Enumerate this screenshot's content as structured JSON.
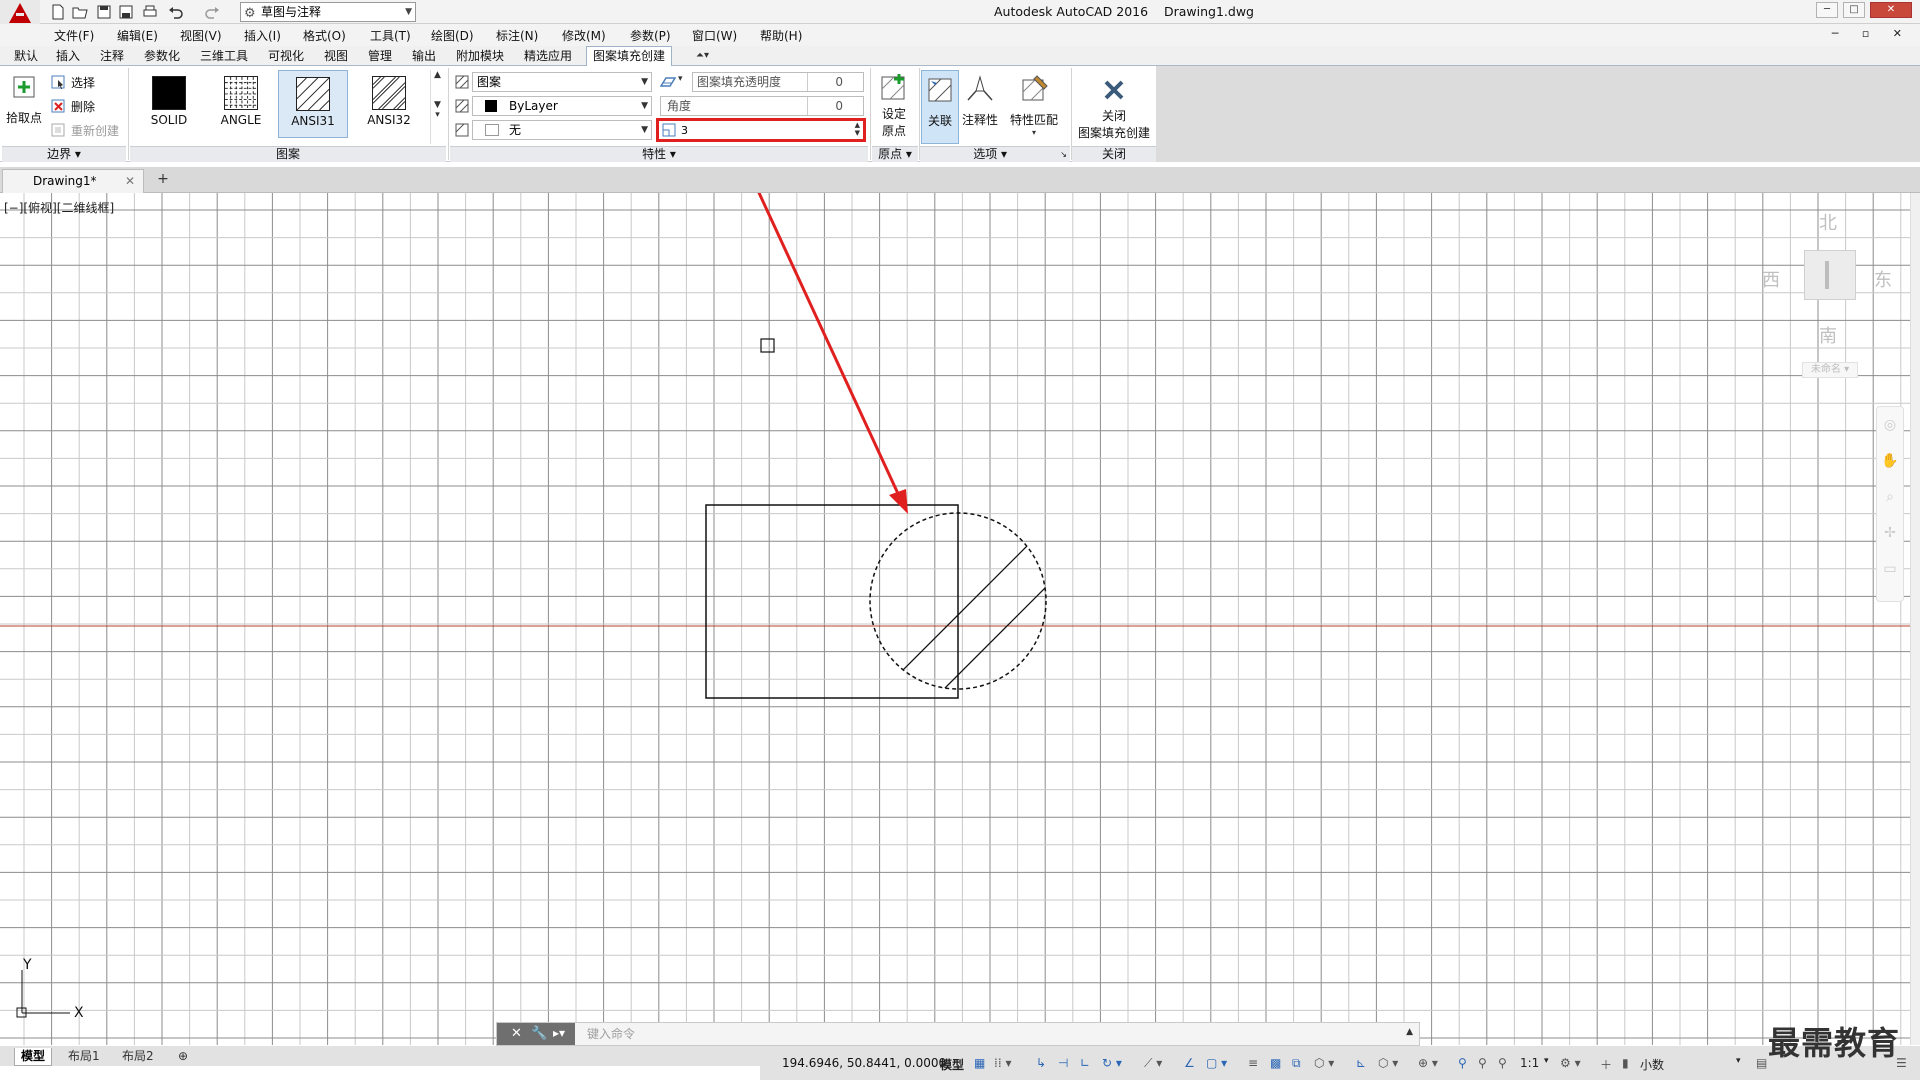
{
  "titlebar": {
    "app_title": "Autodesk AutoCAD 2016",
    "doc_title": "Drawing1.dwg",
    "workspace": "草图与注释",
    "window_buttons": [
      "─",
      "□",
      "✕"
    ]
  },
  "menubar": {
    "items": [
      "文件(F)",
      "编辑(E)",
      "视图(V)",
      "插入(I)",
      "格式(O)",
      "工具(T)",
      "绘图(D)",
      "标注(N)",
      "修改(M)",
      "参数(P)",
      "窗口(W)",
      "帮助(H)"
    ]
  },
  "ribbon_tabs": {
    "items": [
      "默认",
      "插入",
      "注释",
      "参数化",
      "三维工具",
      "可视化",
      "视图",
      "管理",
      "输出",
      "附加模块",
      "精选应用",
      "图案填充创建"
    ],
    "active_index": 11
  },
  "ribbon": {
    "boundary": {
      "pick_points": "拾取点",
      "select": "选择",
      "remove": "删除",
      "recreate": "重新创建",
      "panel_title": "边界"
    },
    "pattern": {
      "tiles": [
        "SOLID",
        "ANGLE",
        "ANSI31",
        "ANSI32"
      ],
      "selected": "ANSI31",
      "panel_title": "图案"
    },
    "properties": {
      "type_value": "图案",
      "color_value": "ByLayer",
      "bg_value": "无",
      "transparency_label": "图案填充透明度",
      "transparency_value": "0",
      "angle_label": "角度",
      "angle_value": "0",
      "scale_value": "3",
      "panel_title": "特性"
    },
    "origin": {
      "set_origin_line1": "设定",
      "set_origin_line2": "原点",
      "panel_title": "原点"
    },
    "options": {
      "associative": "关联",
      "annotative": "注释性",
      "match_props": "特性匹配",
      "panel_title": "选项"
    },
    "close": {
      "label_line1": "关闭",
      "label_line2": "图案填充创建",
      "panel_title": "关闭"
    }
  },
  "doc_tab": {
    "name": "Drawing1*"
  },
  "viewport": {
    "label": "[−][俯视][二维线框]"
  },
  "viewcube": {
    "north": "北",
    "south": "南",
    "east": "东",
    "west": "西",
    "ucs_name": "未命名"
  },
  "ucs": {
    "x": "X",
    "y": "Y"
  },
  "cmdline": {
    "placeholder": "键入命令"
  },
  "layout_tabs": [
    "模型",
    "布局1",
    "布局2"
  ],
  "statusbar": {
    "coords": "194.6946, 50.8441, 0.0000",
    "model": "模型",
    "scale": "1:1",
    "units": "小数"
  },
  "watermark": "最需教育",
  "colors": {
    "accent_red": "#e0201e",
    "x_axis_line": "#b8402f",
    "selected_blue": "#dbe9f7"
  }
}
